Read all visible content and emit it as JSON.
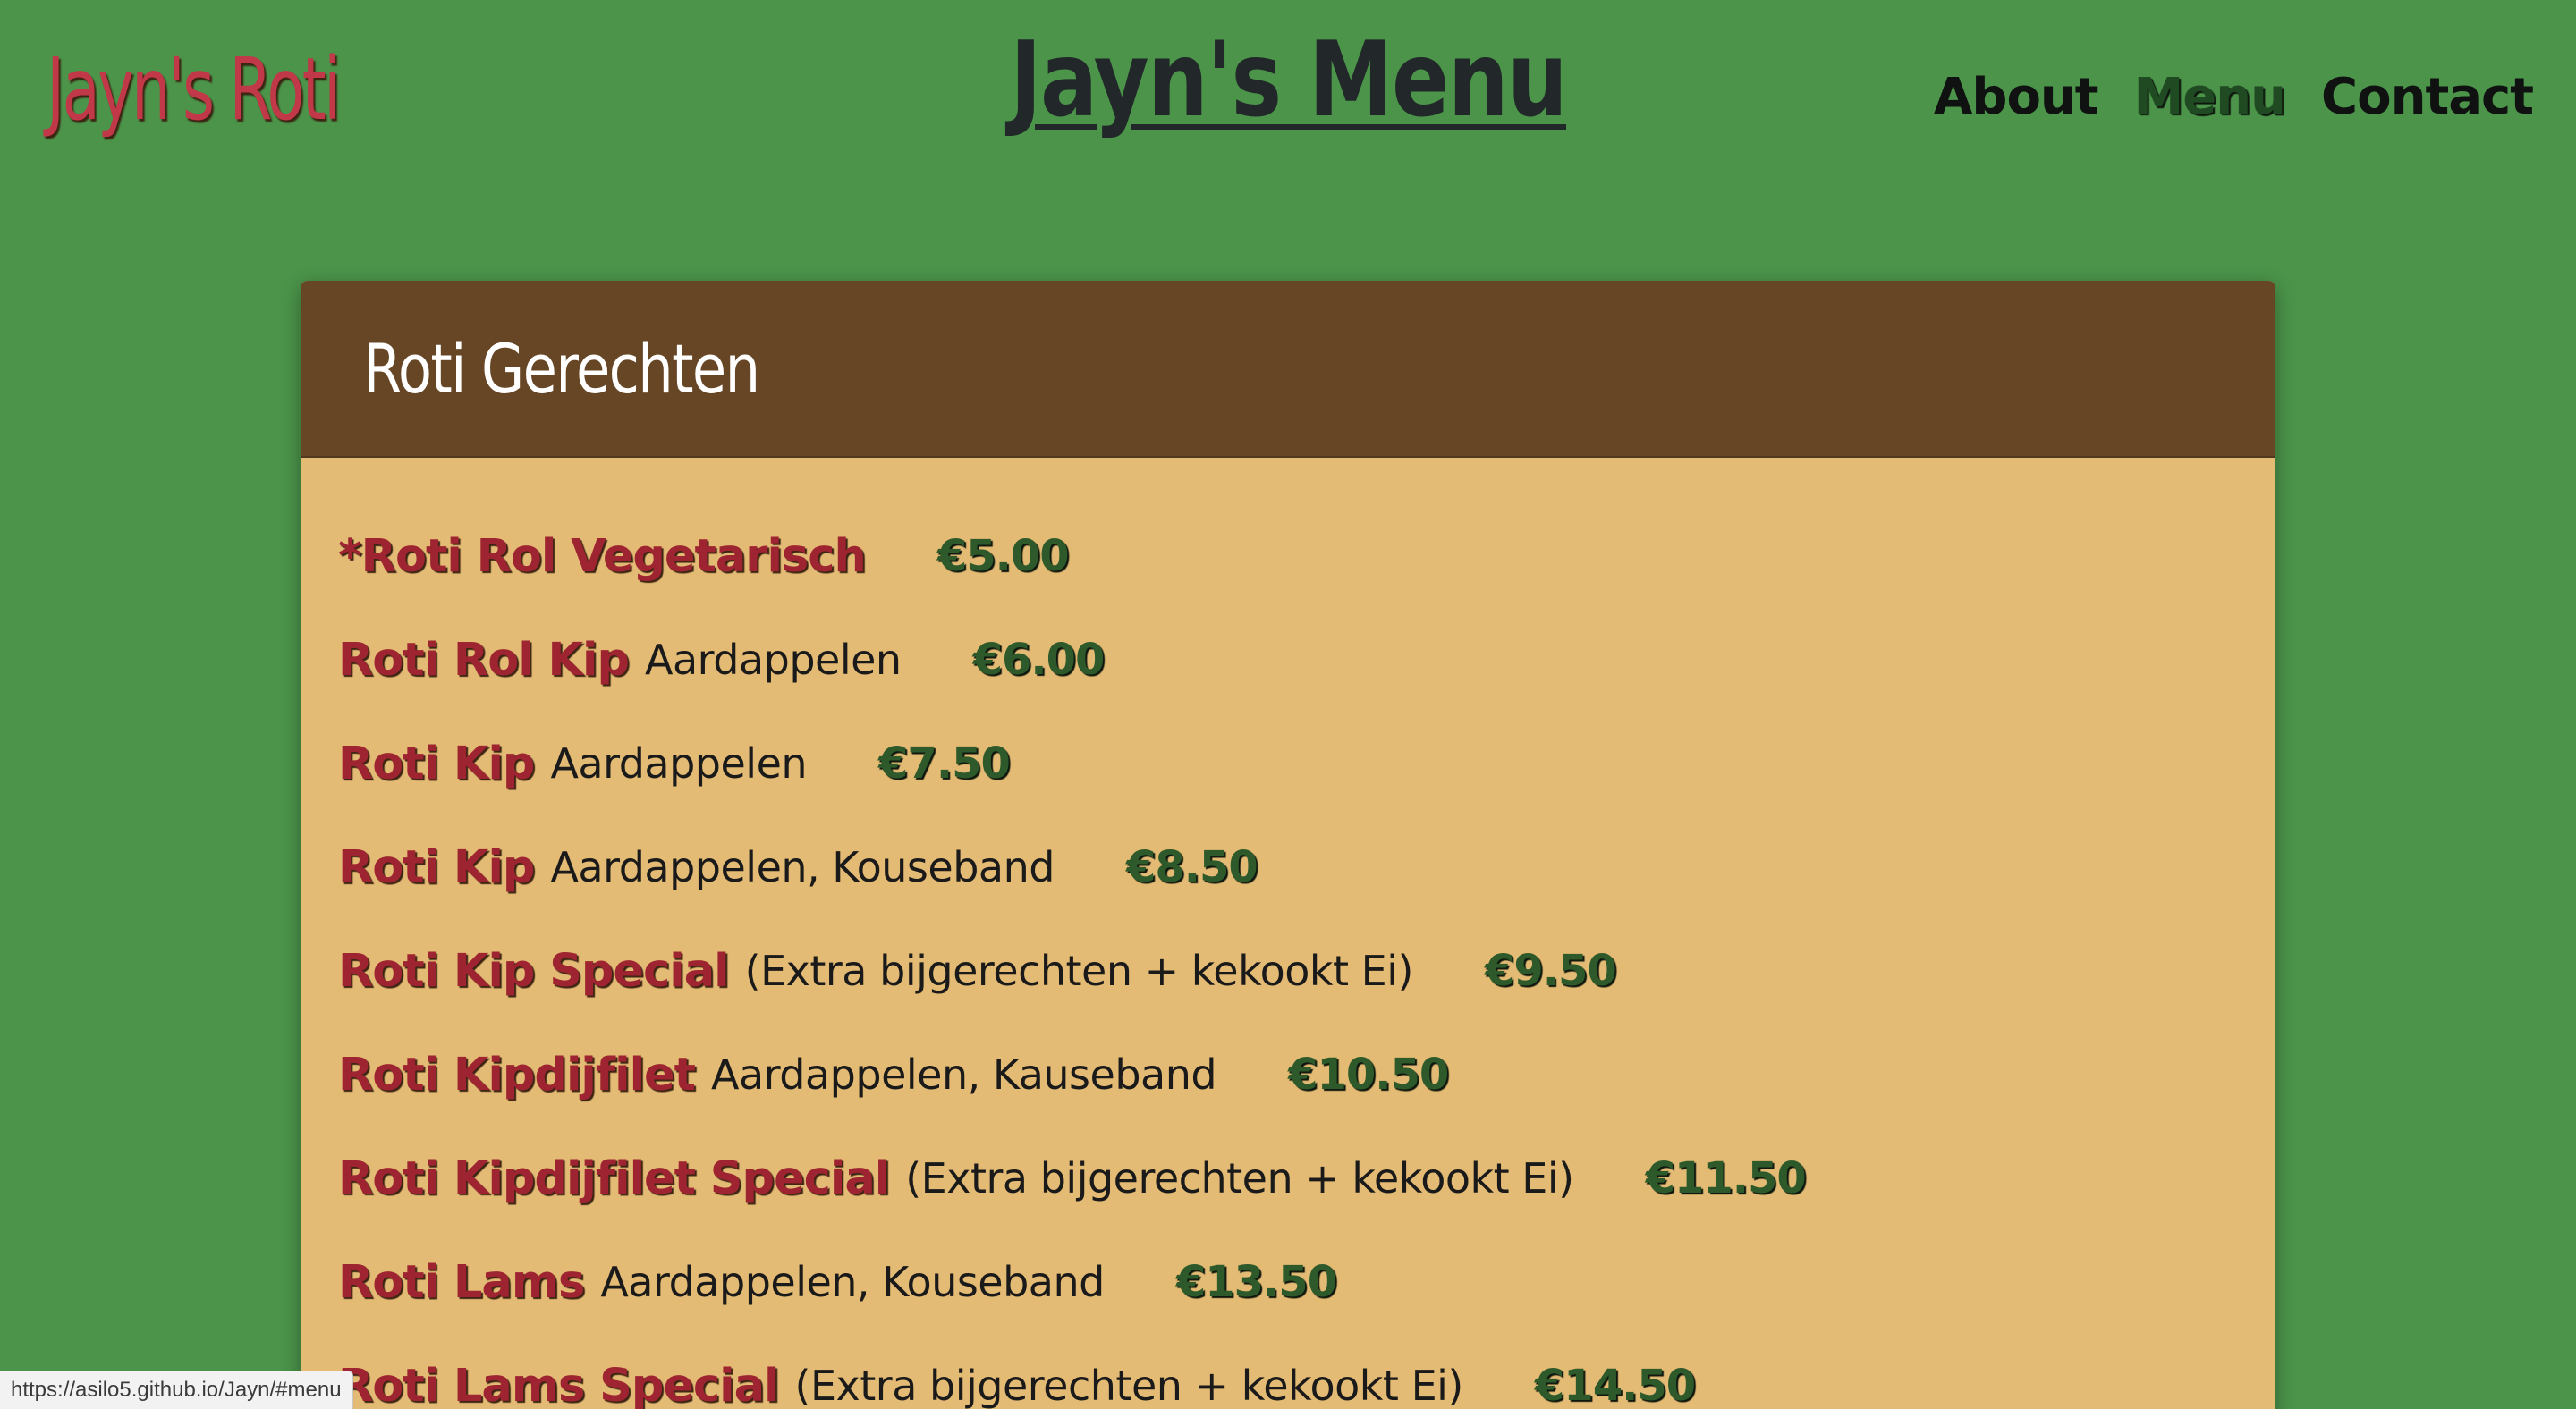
{
  "header": {
    "brand": "Jayn's Roti",
    "title": "Jayn's Menu"
  },
  "nav": {
    "items": [
      {
        "label": "About",
        "active": false
      },
      {
        "label": "Menu",
        "active": true
      },
      {
        "label": "Contact",
        "active": false
      }
    ]
  },
  "menu": {
    "section_title": "Roti Gerechten",
    "items": [
      {
        "name": "*Roti Rol Vegetarisch",
        "description": "",
        "price": "€5.00"
      },
      {
        "name": "Roti Rol Kip",
        "description": "Aardappelen",
        "price": "€6.00"
      },
      {
        "name": "Roti Kip",
        "description": "Aardappelen",
        "price": "€7.50"
      },
      {
        "name": "Roti Kip",
        "description": "Aardappelen, Kouseband",
        "price": "€8.50"
      },
      {
        "name": "Roti Kip Special",
        "description": "(Extra bijgerechten + kekookt Ei)",
        "price": "€9.50"
      },
      {
        "name": "Roti Kipdijfilet",
        "description": "Aardappelen, Kauseband",
        "price": "€10.50"
      },
      {
        "name": "Roti Kipdijfilet Special",
        "description": "(Extra bijgerechten + kekookt Ei)",
        "price": "€11.50"
      },
      {
        "name": "Roti Lams",
        "description": "Aardappelen, Kouseband",
        "price": "€13.50"
      },
      {
        "name": "Roti Lams Special",
        "description": "(Extra bijgerechten + kekookt Ei)",
        "price": "€14.50"
      }
    ]
  },
  "status_bar": {
    "url": "https://asilo5.github.io/Jayn/#menu"
  },
  "colors": {
    "background": "#4b944a",
    "brand": "#c13848",
    "card_header": "#664625",
    "card_body": "#e4bb74",
    "item_name": "#9d2430",
    "price": "#2e5a2b"
  }
}
